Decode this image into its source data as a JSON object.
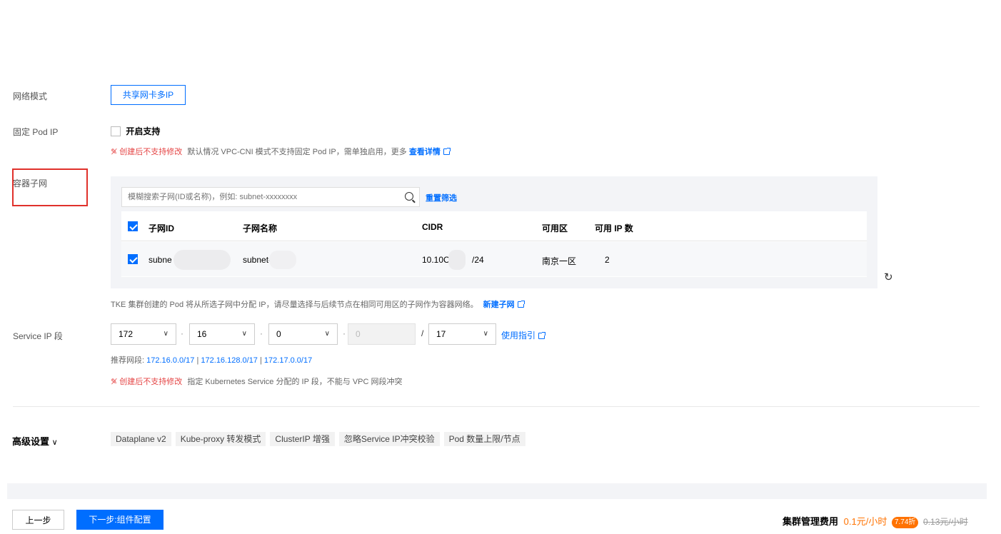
{
  "network_mode": {
    "label": "网络模式",
    "value": "共享网卡多IP"
  },
  "fixed_pod_ip": {
    "label": "固定 Pod IP",
    "checkbox_label": "开启支持",
    "warn_text": "创建后不支持修改",
    "desc": "默认情况 VPC-CNI 模式不支持固定 Pod IP，需单独启用，更多",
    "link": "查看详情"
  },
  "container_subnet": {
    "label": "容器子网",
    "search_placeholder": "模糊搜索子网(ID或名称)，例如: subnet-xxxxxxxx",
    "reset": "重置筛选",
    "columns": [
      "子网ID",
      "子网名称",
      "CIDR",
      "可用区",
      "可用 IP 数"
    ],
    "rows": [
      {
        "id": "subne",
        "name": "subnet-",
        "cidr_prefix": "10.10C",
        "cidr_suffix": "/24",
        "zone": "南京一区",
        "available": "2"
      }
    ],
    "note": "TKE 集群创建的 Pod 将从所选子网中分配 IP，请尽量选择与后续节点在相同可用区的子网作为容器网络。",
    "new_link": "新建子网"
  },
  "service_ip": {
    "label": "Service IP 段",
    "octets": [
      "172",
      "16",
      "0",
      "0"
    ],
    "mask": "17",
    "guide": "使用指引",
    "recommend_label": "推荐网段:",
    "recommended": [
      "172.16.0.0/17",
      "172.16.128.0/17",
      "172.17.0.0/17"
    ],
    "warn_text": "创建后不支持修改",
    "desc": "指定 Kubernetes Service 分配的 IP 段，不能与 VPC 网段冲突"
  },
  "advanced": {
    "label": "高级设置",
    "tags": [
      "Dataplane v2",
      "Kube-proxy 转发模式",
      "ClusterIP 增强",
      "忽略Service IP冲突校验",
      "Pod 数量上限/节点"
    ]
  },
  "footer": {
    "prev": "上一步",
    "next": "下一步:组件配置",
    "fee_label": "集群管理费用",
    "price": "0.1元/小时",
    "discount": "7.74折",
    "original": "0.13元/小时"
  },
  "colors": {
    "accent": "#006eff",
    "warning": "#e54545",
    "price": "#ff7200"
  }
}
